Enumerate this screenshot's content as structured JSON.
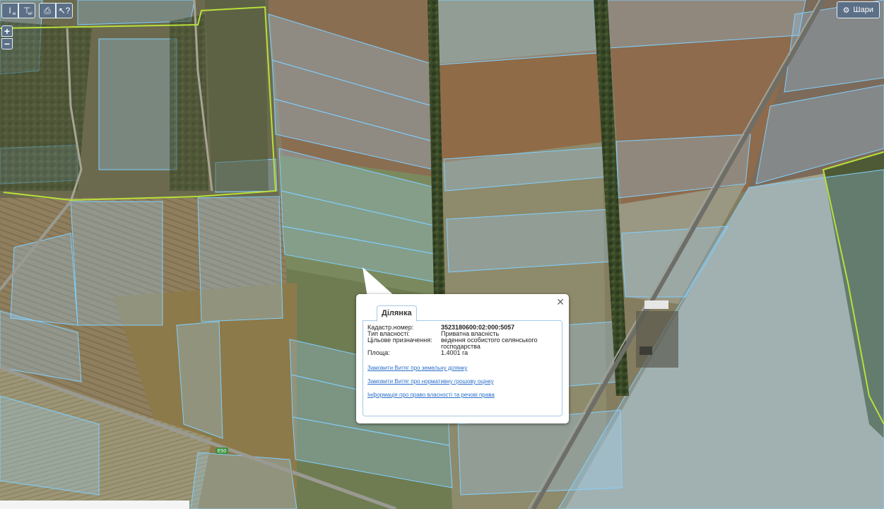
{
  "toolbar": {
    "measure_length_icon": "ruler-vertical-icon",
    "measure_length_sub": "м",
    "measure_area_icon": "ruler-area-icon",
    "measure_area_sub": "м²",
    "print_icon": "printer-icon",
    "identify_icon": "pointer-help-icon"
  },
  "zoom": {
    "in_label": "+",
    "out_label": "−"
  },
  "layers": {
    "label": "Шари",
    "icon": "gear-icon"
  },
  "map": {
    "road_label": "E50"
  },
  "popup": {
    "tab_label": "Ділянка",
    "close_label": "✕",
    "fields": [
      {
        "key": "Кадастр.номер:",
        "value": "3523180600:02:000:5057"
      },
      {
        "key": "Тип власності:",
        "value": "Приватна власність"
      },
      {
        "key": "Цільове призначення:",
        "value": "ведення особистого селянського господарства"
      },
      {
        "key": "Площа:",
        "value": "1.4001 га"
      }
    ],
    "links": [
      "Замовити Витяг про земельну ділянку",
      "Замовити Витяг про нормативну грошову оцінку",
      "Інформація про право власності та речові права"
    ]
  },
  "colors": {
    "parcel_outline": "#7fd0ff",
    "boundary": "#b8e03a",
    "link": "#2a6fc9"
  }
}
